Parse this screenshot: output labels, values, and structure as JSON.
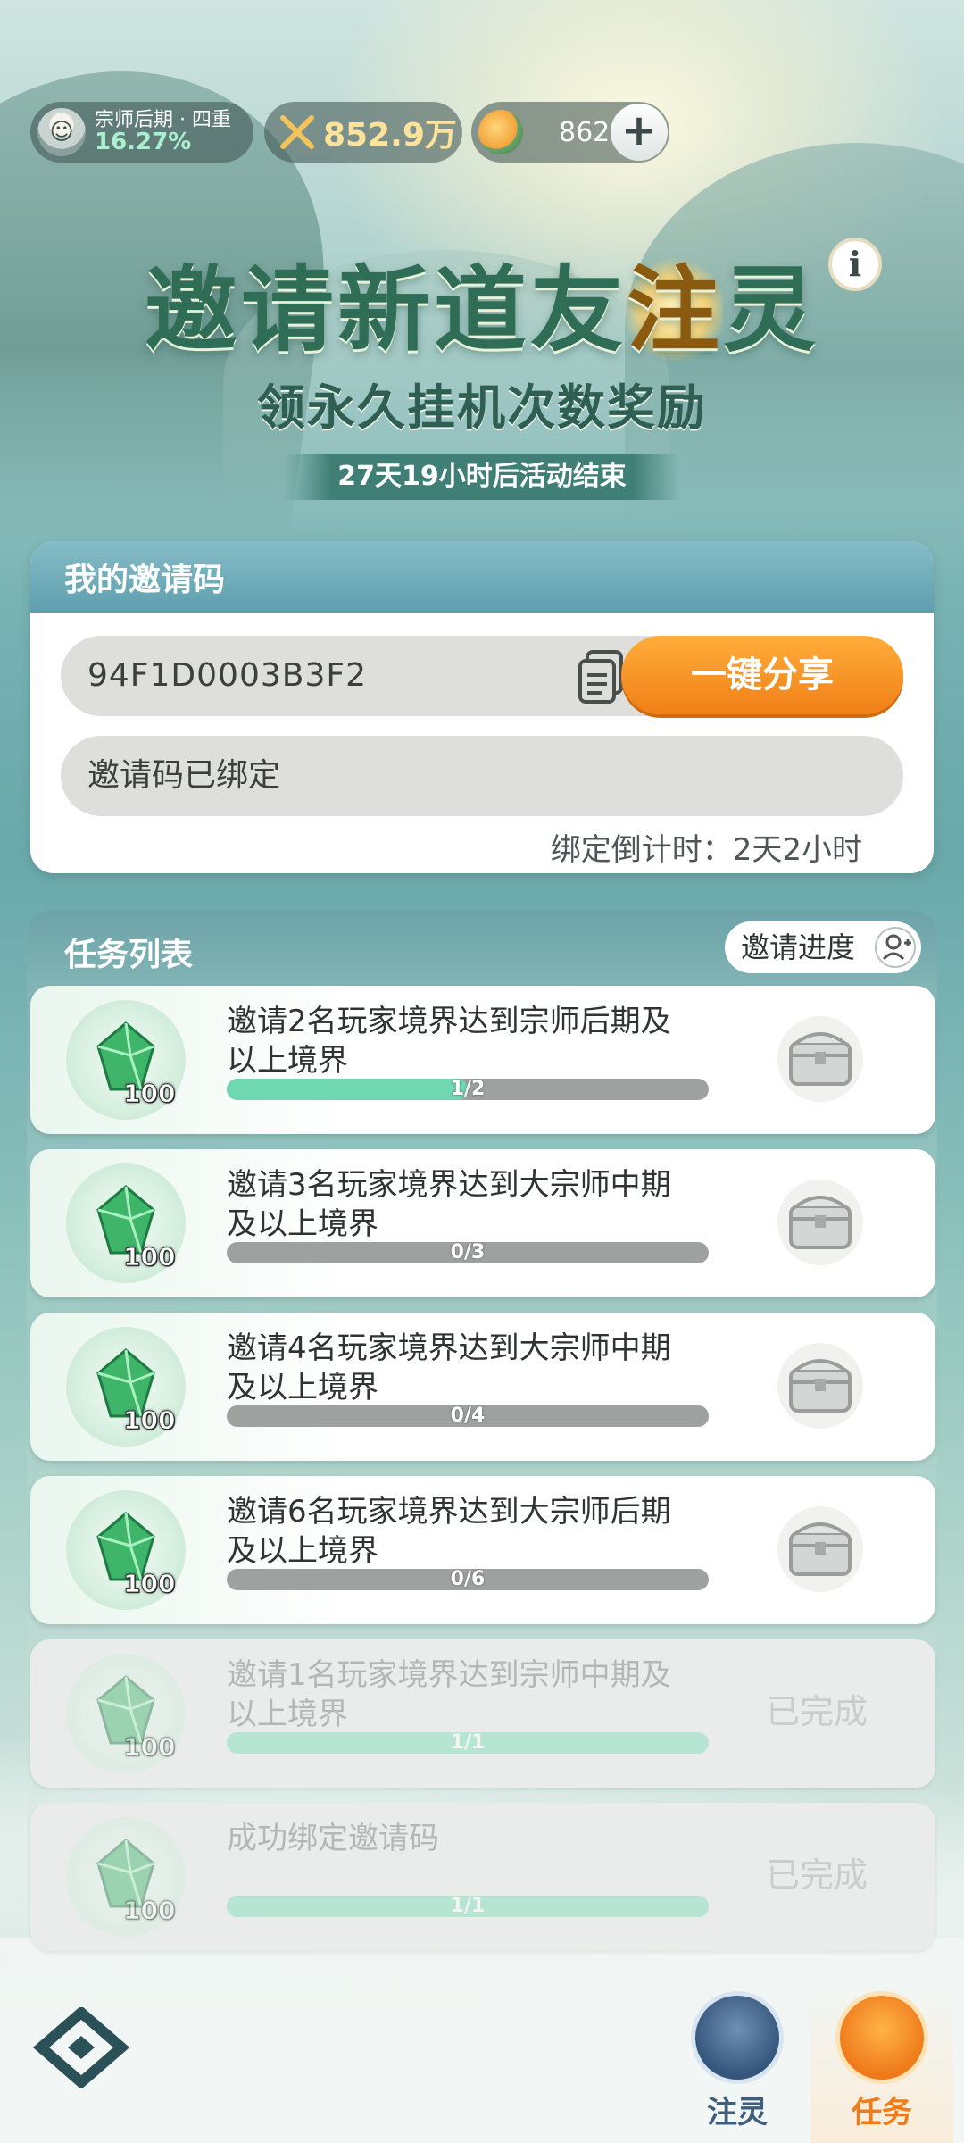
{
  "status": {
    "rank_name": "宗师后期 · 四重",
    "rank_percent": "16.27%",
    "power": "852.9万",
    "currency": "8628",
    "plus": "+"
  },
  "banner": {
    "title_part1": "邀请新道友",
    "title_highlight": "注",
    "title_part2": "灵",
    "info": "i",
    "subtitle": "领永久挂机次数奖励",
    "countdown": "27天19小时后活动结束"
  },
  "invite": {
    "header": "我的邀请码",
    "code": "94F1D0003B3F2",
    "share_label": "一键分享",
    "bound_status": "邀请码已绑定",
    "bind_timer": "绑定倒计时：2天2小时"
  },
  "tasks": {
    "header": "任务列表",
    "progress_label": "邀请进度",
    "items": [
      {
        "title": "邀请2名玩家境界达到宗师后期及以上境界",
        "reward": "100",
        "progress": "1/2",
        "fraction": 0.5,
        "done": false
      },
      {
        "title": "邀请3名玩家境界达到大宗师中期及以上境界",
        "reward": "100",
        "progress": "0/3",
        "fraction": 0,
        "done": false
      },
      {
        "title": "邀请4名玩家境界达到大宗师中期及以上境界",
        "reward": "100",
        "progress": "0/4",
        "fraction": 0,
        "done": false
      },
      {
        "title": "邀请6名玩家境界达到大宗师后期及以上境界",
        "reward": "100",
        "progress": "0/6",
        "fraction": 0,
        "done": false
      },
      {
        "title": "邀请1名玩家境界达到宗师中期及以上境界",
        "reward": "100",
        "progress": "1/1",
        "fraction": 1,
        "done": true,
        "status": "已完成"
      },
      {
        "title": "成功绑定邀请码",
        "reward": "100",
        "progress": "1/1",
        "fraction": 1,
        "done": true,
        "status": "已完成"
      }
    ]
  },
  "nav": {
    "spirit_label": "注灵",
    "task_label": "任务"
  },
  "colors": {
    "accent_orange": "#f07f16",
    "progress_green": "#6fd7b1",
    "title_green": "#2f6d57"
  }
}
